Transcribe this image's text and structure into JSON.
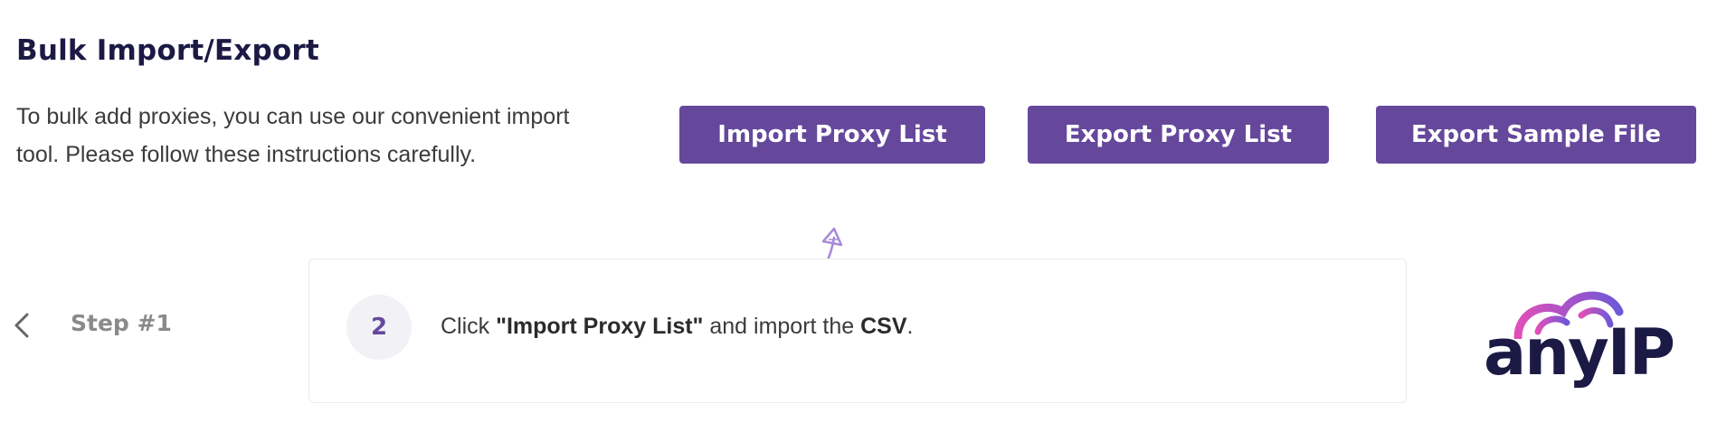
{
  "header": {
    "title": "Bulk Import/Export",
    "intro_line1": "To bulk add proxies, you can use our convenient import",
    "intro_line2": "tool. Please follow these instructions carefully."
  },
  "actions": {
    "import_label": "Import Proxy List",
    "export_label": "Export Proxy List",
    "sample_label": "Export Sample File"
  },
  "step": {
    "nav_label": "Step #1",
    "number": "2",
    "text_prefix": "Click ",
    "text_bold1": "\"Import Proxy List\"",
    "text_middle": " and import the ",
    "text_bold2": "CSV",
    "text_suffix": "."
  },
  "brand": {
    "logo_text": "anyIP",
    "accent": "#65489c",
    "title_color": "#1b1a45"
  },
  "icons": {
    "prev": "chevron-left-icon",
    "arrow": "hand-drawn-arrow-icon"
  }
}
